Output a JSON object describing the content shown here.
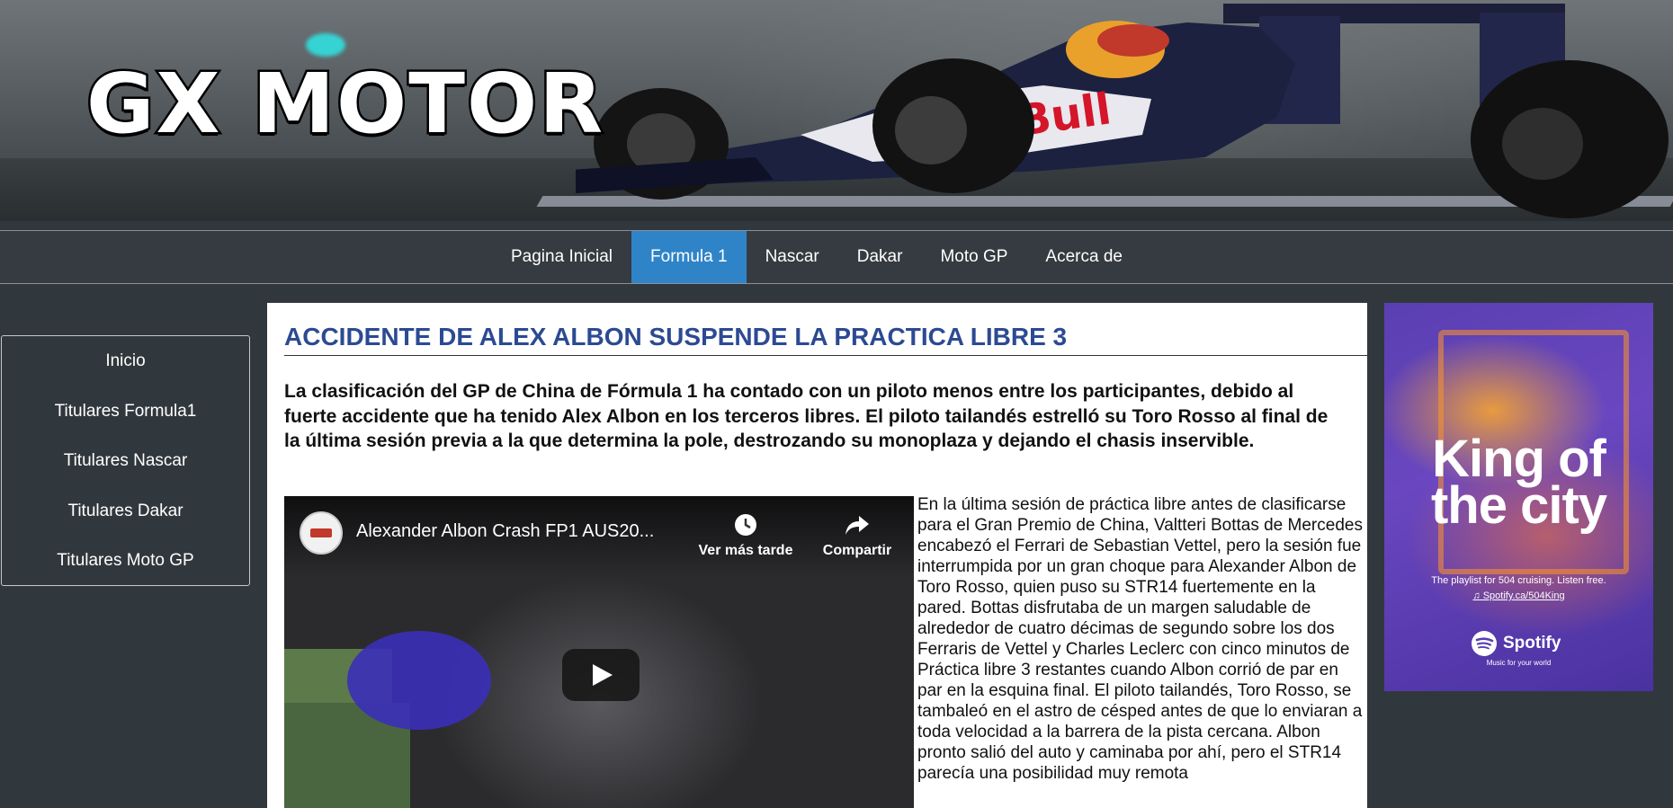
{
  "brand": {
    "logo_text": "GX MOTOR"
  },
  "nav": {
    "items": [
      {
        "label": "Pagina Inicial"
      },
      {
        "label": "Formula 1"
      },
      {
        "label": "Nascar"
      },
      {
        "label": "Dakar"
      },
      {
        "label": "Moto GP"
      },
      {
        "label": "Acerca de"
      }
    ],
    "active": "Formula 1",
    "active_color": "#2f84c8"
  },
  "sidebar": {
    "items": [
      {
        "label": "Inicio"
      },
      {
        "label": "Titulares Formula1"
      },
      {
        "label": "Titulares Nascar"
      },
      {
        "label": "Titulares Dakar"
      },
      {
        "label": "Titulares Moto GP"
      }
    ]
  },
  "article": {
    "title": "ACCIDENTE DE ALEX ALBON SUSPENDE LA PRACTICA LIBRE 3",
    "title_color": "#2c4a93",
    "lead": "La clasificación del GP de China de Fórmula 1 ha contado con un piloto menos entre los participantes, debido al fuerte accidente que ha tenido Alex Albon en los terceros libres. El piloto tailandés estrelló su Toro Rosso al final de la última sesión previa a la que determina la pole, destrozando su monoplaza y dejando el chasis inservible.",
    "body": "En la última sesión de práctica libre antes de clasificarse para el Gran Premio de China, Valtteri Bottas de Mercedes encabezó el Ferrari de Sebastian Vettel, pero la sesión fue interrumpida por un gran choque para Alexander Albon de Toro Rosso, quien puso su STR14 fuertemente en la pared. Bottas disfrutaba de un margen saludable de alrededor de cuatro décimas de segundo sobre los dos Ferraris de Vettel y Charles Leclerc con cinco minutos de Práctica libre 3 restantes cuando Albon corrió de par en par en la esquina final. El piloto tailandés, Toro Rosso, se tambaleó en el astro de césped antes de que lo enviaran a toda velocidad a la barrera de la pista cercana. Albon pronto salió del auto y caminaba por ahí, pero el STR14 parecía una posibilidad muy remota"
  },
  "video": {
    "title": "Alexander Albon Crash FP1 AUS20...",
    "watch_later": "Ver más tarde",
    "share": "Compartir",
    "icons": [
      "clock-icon",
      "share-arrow-icon",
      "play-icon"
    ]
  },
  "ad": {
    "headline_line1": "King of",
    "headline_line2": "the city",
    "tagline": "The playlist for 504 cruising. Listen free.",
    "url": "♫ Spotify.ca/504King",
    "brand": "Spotify",
    "brand_sub": "Music for your world",
    "bg_color": "#5a3fb2"
  }
}
